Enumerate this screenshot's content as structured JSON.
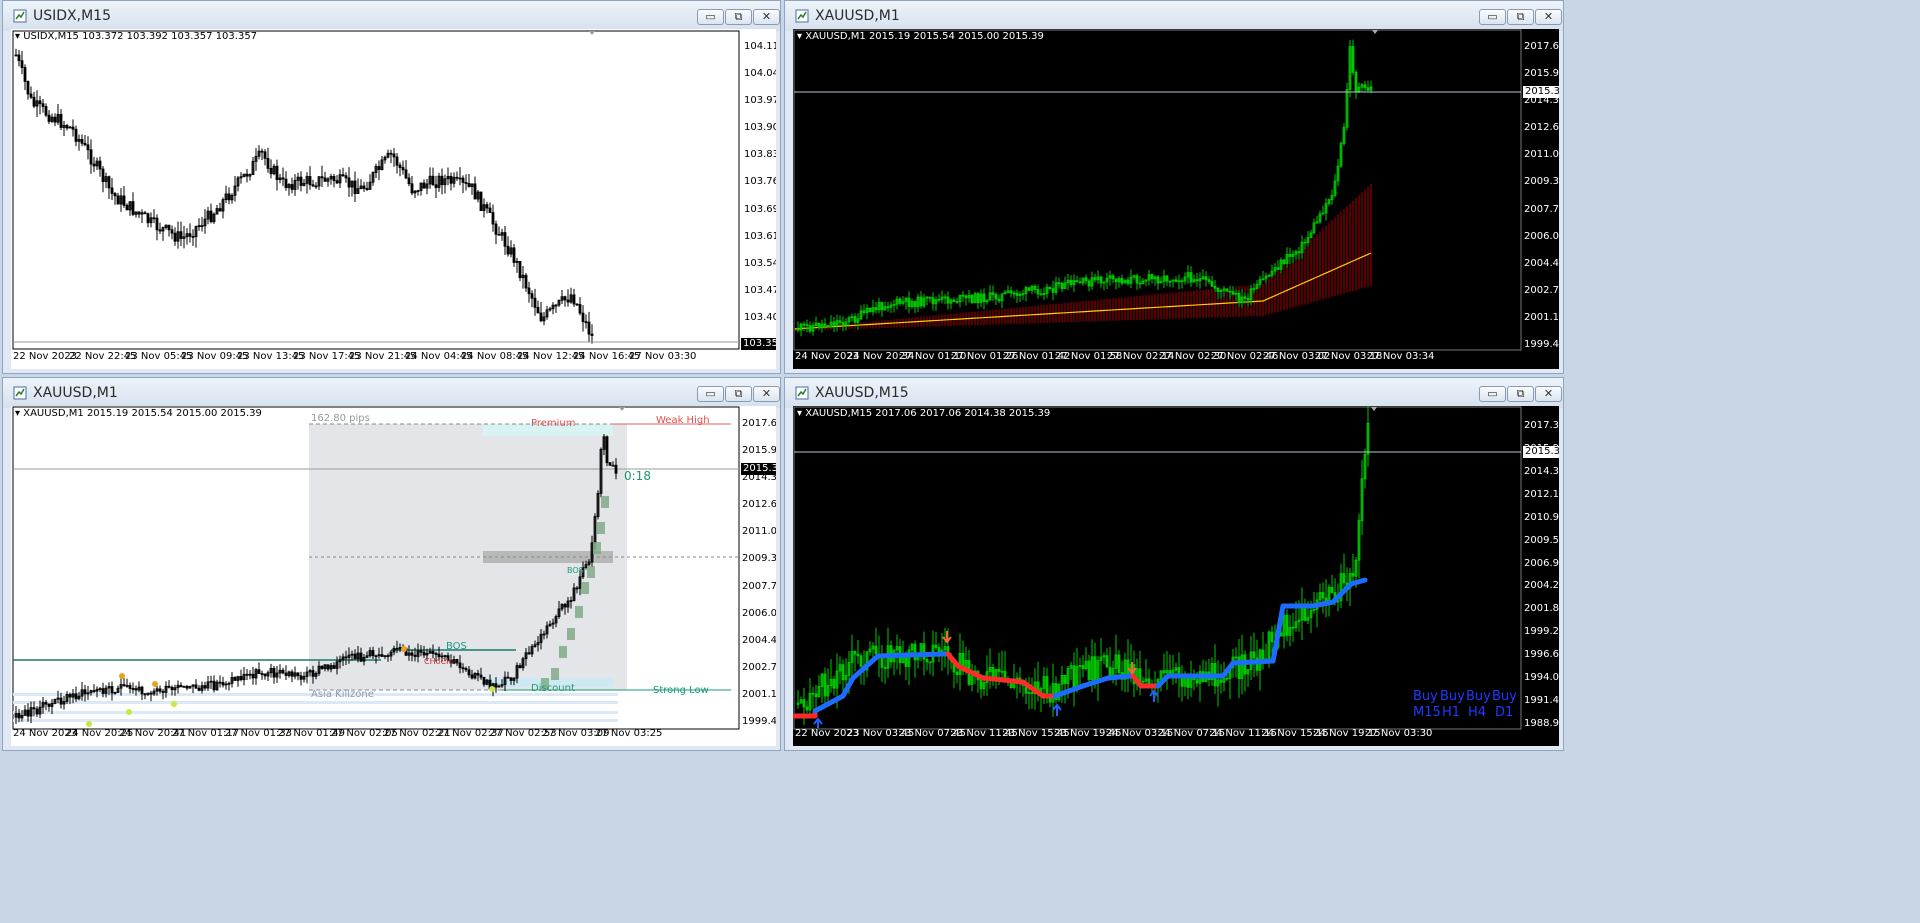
{
  "windows": {
    "w1": {
      "title": "USIDX,M15",
      "info": "USIDX,M15  103.372 103.392 103.357 103.357",
      "yticks": [
        "104.115",
        "104.045",
        "103.975",
        "103.900",
        "103.830",
        "103.760",
        "103.690",
        "103.615",
        "103.545",
        "103.475",
        "103.405",
        "103.335"
      ],
      "price_label": "103.357",
      "xticks": [
        "22 Nov 2023",
        "22 Nov 22:45",
        "23 Nov 05:45",
        "23 Nov 09:45",
        "23 Nov 13:45",
        "23 Nov 17:45",
        "23 Nov 21:45",
        "24 Nov 04:45",
        "24 Nov 08:45",
        "24 Nov 12:45",
        "24 Nov 16:45",
        "27 Nov 03:30"
      ]
    },
    "w2": {
      "title": "XAUUSD,M1",
      "info": "XAUUSD,M1  2015.19 2015.54 2015.00 2015.39",
      "yticks": [
        "2017.60",
        "2015.95",
        "2014.30",
        "2012.65",
        "2011.00",
        "2009.35",
        "2007.70",
        "2006.05",
        "2004.40",
        "2002.75",
        "2001.10",
        "1999.45"
      ],
      "price_label": "2015.39",
      "xticks": [
        "24 Nov 2023",
        "24 Nov 20:34",
        "27 Nov 01:10",
        "27 Nov 01:26",
        "27 Nov 01:42",
        "27 Nov 01:58",
        "27 Nov 02:14",
        "27 Nov 02:30",
        "27 Nov 02:46",
        "27 Nov 03:02",
        "27 Nov 03:18",
        "27 Nov 03:34"
      ]
    },
    "w3": {
      "title": "XAUUSD,M1",
      "info": "XAUUSD,M1  2015.19 2015.54 2015.00 2015.39",
      "yticks": [
        "2017.60",
        "2015.95",
        "2014.30",
        "2012.65",
        "2011.00",
        "2009.35",
        "2007.70",
        "2006.05",
        "2004.40",
        "2002.75",
        "2001.10",
        "1999.45"
      ],
      "price_label": "2015.39",
      "xticks": [
        "24 Nov 2023",
        "24 Nov 20:25",
        "24 Nov 20:41",
        "27 Nov 01:17",
        "27 Nov 01:33",
        "27 Nov 01:49",
        "27 Nov 02:05",
        "27 Nov 02:21",
        "27 Nov 02:37",
        "27 Nov 02:53",
        "27 Nov 03:09",
        "27 Nov 03:25"
      ],
      "labels": {
        "pips": "162.80 pips",
        "premium": "Premium",
        "weak_high": "Weak High",
        "discount": "Discount",
        "strong_low": "Strong Low",
        "asia": "Asia Killzone",
        "timer": "0:18",
        "bos": "BOS",
        "bos_small": "BOS",
        "choch": "CHoCH"
      }
    },
    "w4": {
      "title": "XAUUSD,M15",
      "info": "XAUUSD,M15  2017.06 2017.06 2014.38 2015.39",
      "yticks": [
        "2017.30",
        "2015.95",
        "2014.30",
        "2012.10",
        "2010.90",
        "2009.55",
        "2006.95",
        "2004.25",
        "2001.80",
        "1999.20",
        "1996.65",
        "1994.05",
        "1991.45",
        "1988.90"
      ],
      "price_label": "2015.39",
      "xticks": [
        "22 Nov 2023",
        "23 Nov 03:45",
        "23 Nov 07:45",
        "23 Nov 11:45",
        "23 Nov 15:45",
        "23 Nov 19:45",
        "24 Nov 03:15",
        "24 Nov 07:15",
        "24 Nov 11:15",
        "24 Nov 15:15",
        "24 Nov 19:15",
        "27 Nov 03:30"
      ],
      "signals": [
        {
          "top": "Buy",
          "bottom": "M15"
        },
        {
          "top": "Buy",
          "bottom": "H1"
        },
        {
          "top": "Buy",
          "bottom": "H4"
        },
        {
          "top": "Buy",
          "bottom": "D1"
        }
      ]
    }
  },
  "window_buttons": {
    "minimize": "▭",
    "maximize": "⧉",
    "close": "✕"
  },
  "colors": {
    "bull_m1": "#00c800",
    "bear_red": "#c80000",
    "ma_yellow": "#ffd000",
    "trend_blue": "#1e6cff",
    "trend_red": "#ff2a2a",
    "zone_gray": "#e3e5e8"
  }
}
